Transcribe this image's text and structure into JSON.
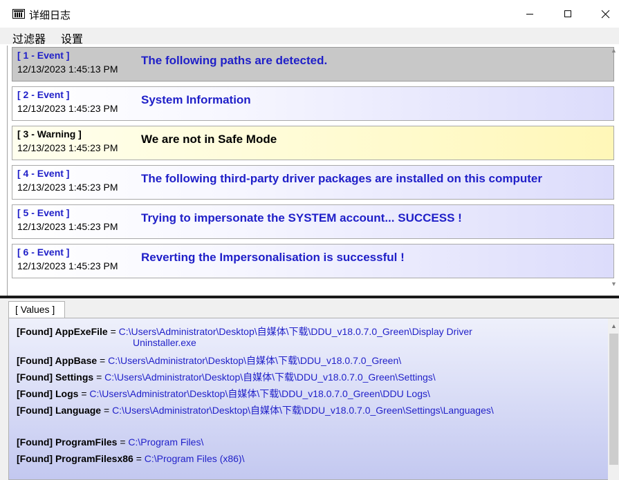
{
  "window": {
    "title": "详细日志",
    "icon": "app-icon",
    "minimize_icon": "minimize-icon",
    "maximize_icon": "maximize-icon",
    "close_icon": "close-icon"
  },
  "menu": {
    "filter": "过滤器",
    "settings": "设置"
  },
  "events": [
    {
      "tag": "[ 1 - Event ]",
      "time": "12/13/2023 1:45:13 PM",
      "message": "The following paths are detected.",
      "type": "event",
      "selected": true
    },
    {
      "tag": "[ 2 - Event ]",
      "time": "12/13/2023 1:45:23 PM",
      "message": "System Information",
      "type": "event",
      "selected": false
    },
    {
      "tag": "[ 3 - Warning ]",
      "time": "12/13/2023 1:45:23 PM",
      "message": "We are not in Safe Mode",
      "type": "warning",
      "selected": false
    },
    {
      "tag": "[ 4 - Event ]",
      "time": "12/13/2023 1:45:23 PM",
      "message": "The following third-party driver packages are installed on this computer",
      "type": "event",
      "selected": false
    },
    {
      "tag": "[ 5 - Event ]",
      "time": "12/13/2023 1:45:23 PM",
      "message": "Trying to impersonate the SYSTEM account... SUCCESS !",
      "type": "event",
      "selected": false
    },
    {
      "tag": "[ 6 - Event ]",
      "time": "12/13/2023 1:45:23 PM",
      "message": "Reverting the Impersonalisation is successful !",
      "type": "event",
      "selected": false
    }
  ],
  "values": {
    "tab_label": "[ Values ]",
    "equals": "=",
    "lines": [
      {
        "key": "[Found] AppExeFile",
        "path": "C:\\Users\\Administrator\\Desktop\\自媒体\\下载\\DDU_v18.0.7.0_Green\\Display Driver",
        "continuation": "Uninstaller.exe"
      },
      {
        "key": "[Found] AppBase",
        "path": "C:\\Users\\Administrator\\Desktop\\自媒体\\下载\\DDU_v18.0.7.0_Green\\"
      },
      {
        "key": "[Found] Settings",
        "path": "C:\\Users\\Administrator\\Desktop\\自媒体\\下载\\DDU_v18.0.7.0_Green\\Settings\\"
      },
      {
        "key": "[Found] Logs",
        "path": "C:\\Users\\Administrator\\Desktop\\自媒体\\下载\\DDU_v18.0.7.0_Green\\DDU Logs\\"
      },
      {
        "key": "[Found] Language",
        "path": "C:\\Users\\Administrator\\Desktop\\自媒体\\下载\\DDU_v18.0.7.0_Green\\Settings\\Languages\\"
      },
      {
        "key": "[Found] ProgramFiles",
        "path": "C:\\Program Files\\"
      },
      {
        "key": "[Found] ProgramFilesx86",
        "path": "C:\\Program Files (x86)\\"
      }
    ]
  },
  "colors": {
    "accent_blue": "#1f1fc8",
    "selected_row": "#c8c8c8",
    "warning_row": "#fffbd2"
  }
}
